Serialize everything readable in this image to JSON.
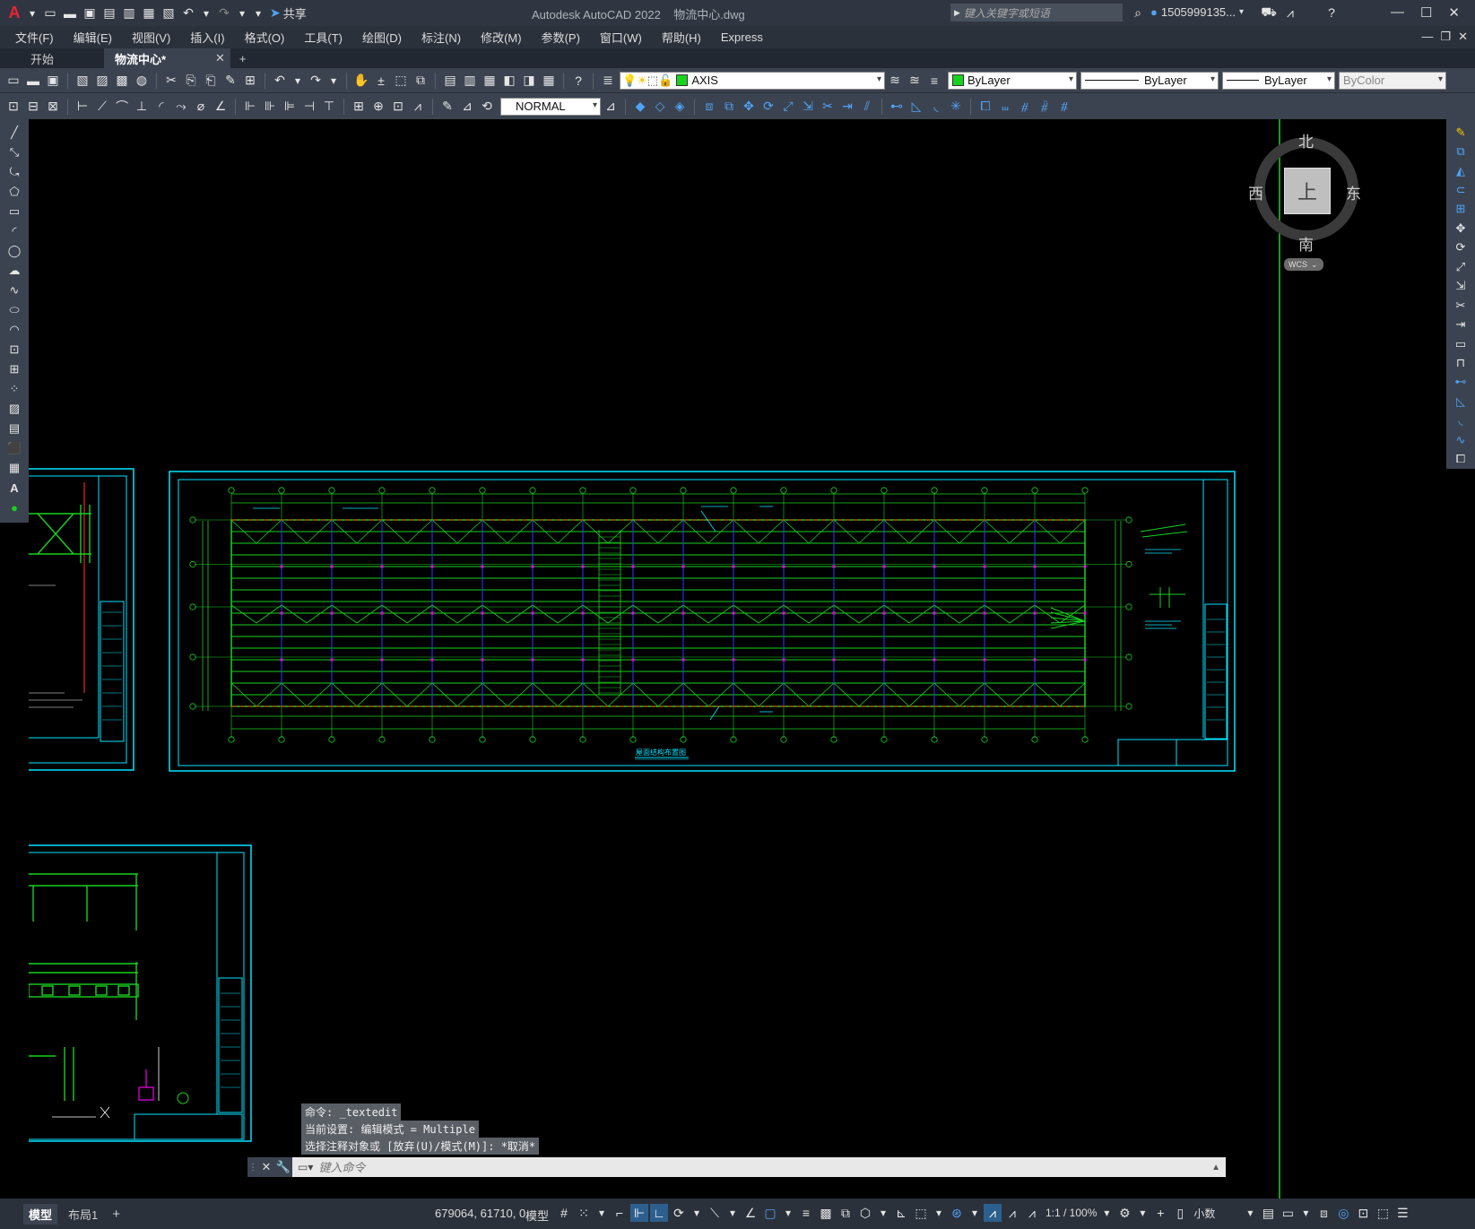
{
  "app": {
    "title": "Autodesk AutoCAD 2022",
    "document": "物流中心.dwg",
    "share_label": "共享",
    "search_placeholder": "键入关键字或短语",
    "user": "1505999135..."
  },
  "menu": [
    "文件(F)",
    "编辑(E)",
    "视图(V)",
    "插入(I)",
    "格式(O)",
    "工具(T)",
    "绘图(D)",
    "标注(N)",
    "修改(M)",
    "参数(P)",
    "窗口(W)",
    "帮助(H)",
    "Express"
  ],
  "tabs": [
    "开始",
    "物流中心*"
  ],
  "toolbar": {
    "layer": "AXIS",
    "color": "ByLayer",
    "linetype": "ByLayer",
    "lineweight": "ByLayer",
    "plotstyle": "ByColor",
    "dimstyle": "NORMAL"
  },
  "viewcube": {
    "north": "北",
    "south": "南",
    "east": "东",
    "west": "西",
    "top": "上",
    "wcs": "WCS"
  },
  "drawing": {
    "main_title": "屋面结构布置图"
  },
  "command": {
    "history": [
      "命令: _textedit",
      "当前设置: 编辑模式 = Multiple",
      "选择注释对象或 [放弃(U)/模式(M)]: *取消*"
    ],
    "placeholder": "键入命令"
  },
  "layout_tabs": [
    "模型",
    "布局1"
  ],
  "status": {
    "coords": "679064, 61710, 0",
    "model": "模型",
    "scale": "1:1 / 100%",
    "units": "小数"
  },
  "colors": {
    "frame": "#00e5ff",
    "grid": "#19d21e",
    "accent": "#4fa3f7"
  }
}
